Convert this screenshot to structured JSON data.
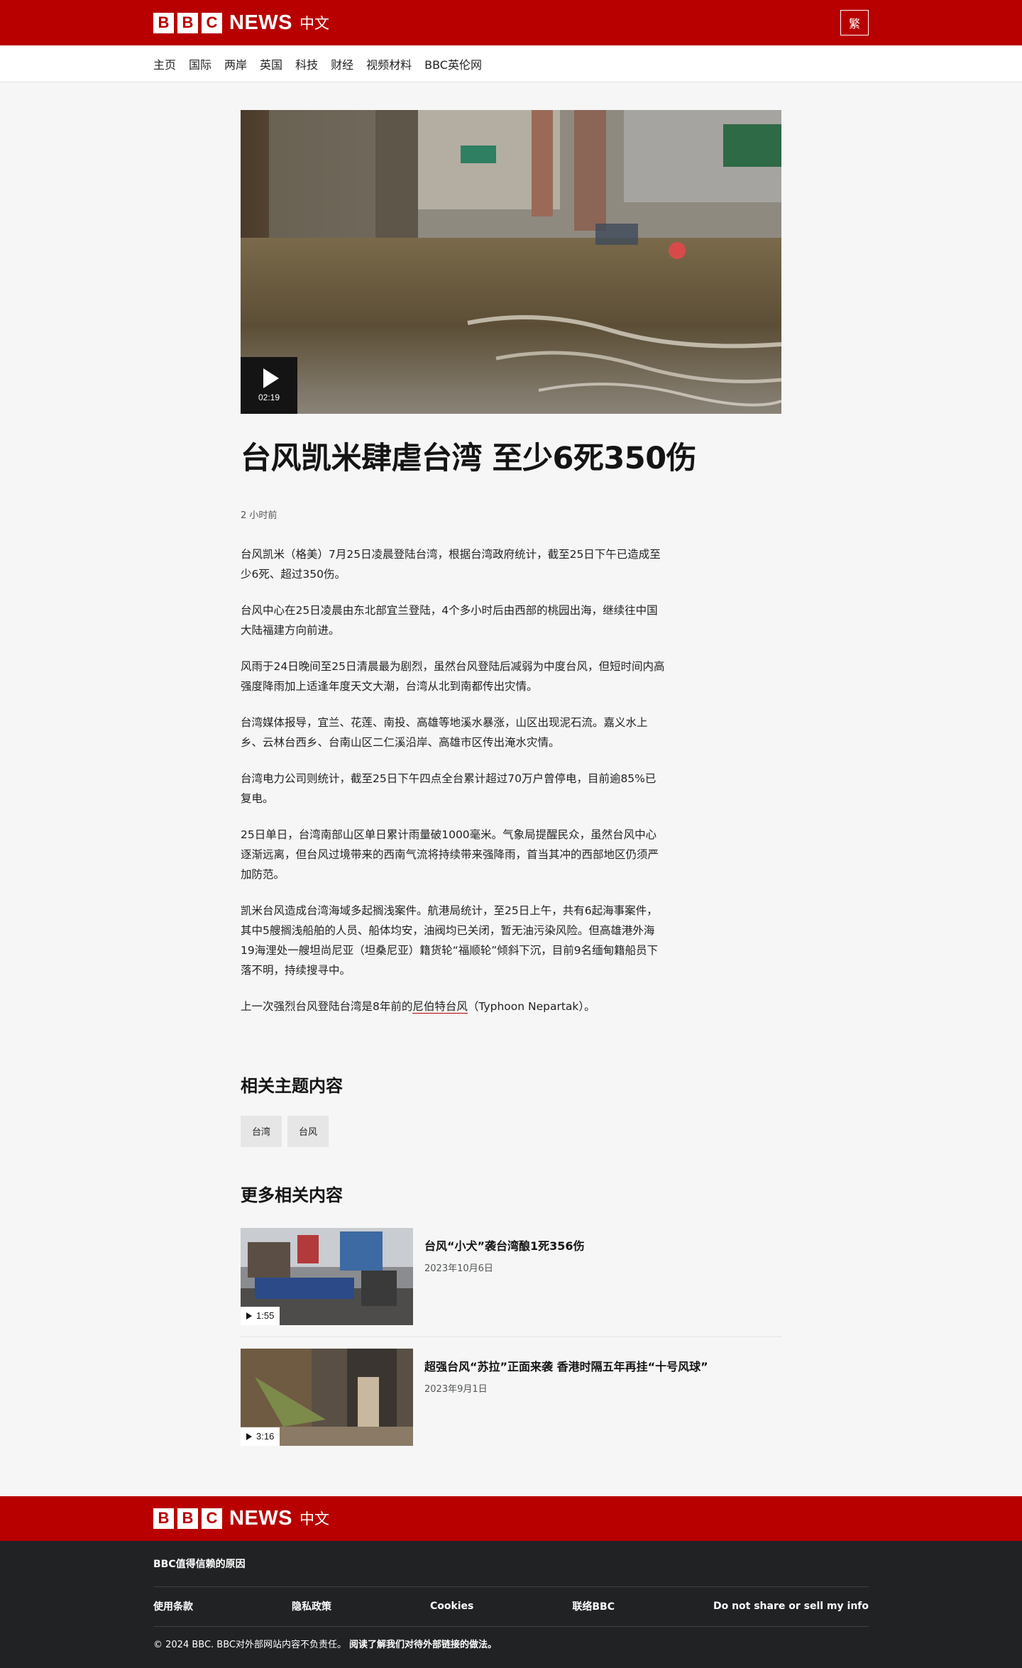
{
  "header": {
    "brand_letters": [
      "B",
      "B",
      "C"
    ],
    "brand_news": "NEWS",
    "brand_lang": "中文",
    "script_toggle": "繁",
    "brand_color": "#b80000"
  },
  "nav": {
    "items": [
      "主页",
      "国际",
      "两岸",
      "英国",
      "科技",
      "财经",
      "视频材料",
      "BBC英伦网"
    ]
  },
  "article": {
    "hero_video_duration": "02:19",
    "hero_icon": "play-icon",
    "headline": "台风凯米肆虐台湾 至少6死350伤",
    "timestamp": "2 小时前",
    "paragraphs": [
      "台风凯米（格美）7月25日凌晨登陆台湾，根据台湾政府统计，截至25日下午已造成至少6死、超过350伤。",
      "台风中心在25日凌晨由东北部宜兰登陆，4个多小时后由西部的桃园出海，继续往中国大陆福建方向前进。",
      "风雨于24日晚间至25日清晨最为剧烈，虽然台风登陆后减弱为中度台风，但短时间内高强度降雨加上适逢年度天文大潮，台湾从北到南都传出灾情。",
      "台湾媒体报导，宜兰、花莲、南投、高雄等地溪水暴涨，山区出现泥石流。嘉义水上乡、云林台西乡、台南山区二仁溪沿岸、高雄市区传出淹水灾情。",
      "台湾电力公司则统计，截至25日下午四点全台累计超过70万户曾停电，目前逾85%已复电。",
      "25日单日，台湾南部山区单日累计雨量破1000毫米。气象局提醒民众，虽然台风中心逐渐远离，但台风过境带来的西南气流将持续带来强降雨，首当其冲的西部地区仍须严加防范。",
      "凯米台风造成台湾海域多起搁浅案件。航港局统计，至25日上午，共有6起海事案件，其中5艘搁浅船舶的人员、船体均安，油阀均已关闭，暂无油污染风险。但高雄港外海19海浬处一艘坦尚尼亚（坦桑尼亚）籍货轮“福顺轮”倾斜下沉，目前9名缅甸籍船员下落不明，持续搜寻中。"
    ],
    "last_para": {
      "before": "上一次强烈台风登陆台湾是8年前的",
      "link": "尼伯特台风",
      "after": "（Typhoon Nepartak）。"
    }
  },
  "topics": {
    "title": "相关主题内容",
    "tags": [
      "台湾",
      "台风"
    ]
  },
  "more": {
    "title": "更多相关内容",
    "stories": [
      {
        "title": "台风“小犬”袭台湾酿1死356伤",
        "date": "2023年10月6日",
        "duration": "1:55"
      },
      {
        "title": "超强台风“苏拉”正面来袭 香港时隔五年再挂“十号风球”",
        "date": "2023年9月1日",
        "duration": "3:16"
      }
    ]
  },
  "footer": {
    "trust_link": "BBC值得信赖的原因",
    "links": [
      "使用条款",
      "隐私政策",
      "Cookies",
      "联络BBC",
      "Do not share or sell my info"
    ],
    "copyright": "© 2024 BBC. BBC对外部网站内容不负责任。",
    "external_link_policy": "阅读了解我们对待外部链接的做法。"
  }
}
